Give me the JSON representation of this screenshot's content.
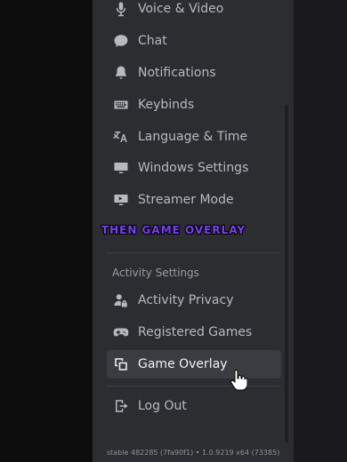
{
  "settings_nav": {
    "items_top": [
      {
        "label": "Voice & Video",
        "icon": "microphone-icon"
      },
      {
        "label": "Chat",
        "icon": "chat-bubble-icon"
      },
      {
        "label": "Notifications",
        "icon": "bell-icon"
      },
      {
        "label": "Keybinds",
        "icon": "keyboard-icon"
      },
      {
        "label": "Language & Time",
        "icon": "translate-icon"
      },
      {
        "label": "Windows Settings",
        "icon": "monitor-icon"
      },
      {
        "label": "Streamer Mode",
        "icon": "streamer-monitor-icon"
      }
    ],
    "activity_section": {
      "header": "Activity Settings",
      "items": [
        {
          "label": "Activity Privacy",
          "icon": "person-lock-icon"
        },
        {
          "label": "Registered Games",
          "icon": "gamepad-icon"
        },
        {
          "label": "Game Overlay",
          "icon": "overlay-icon",
          "selected": true
        }
      ]
    },
    "logout": {
      "label": "Log Out",
      "icon": "logout-icon"
    }
  },
  "video_caption": "THEN GAME OVERLAY",
  "version_text": "stable 482285 (7fa90f1) • 1.0.9219 x64 (73385)",
  "colors": {
    "panel_bg": "#2b2d31",
    "selected_bg": "#393c41",
    "text": "#b5bac1",
    "caption": "#7b3ff2"
  }
}
